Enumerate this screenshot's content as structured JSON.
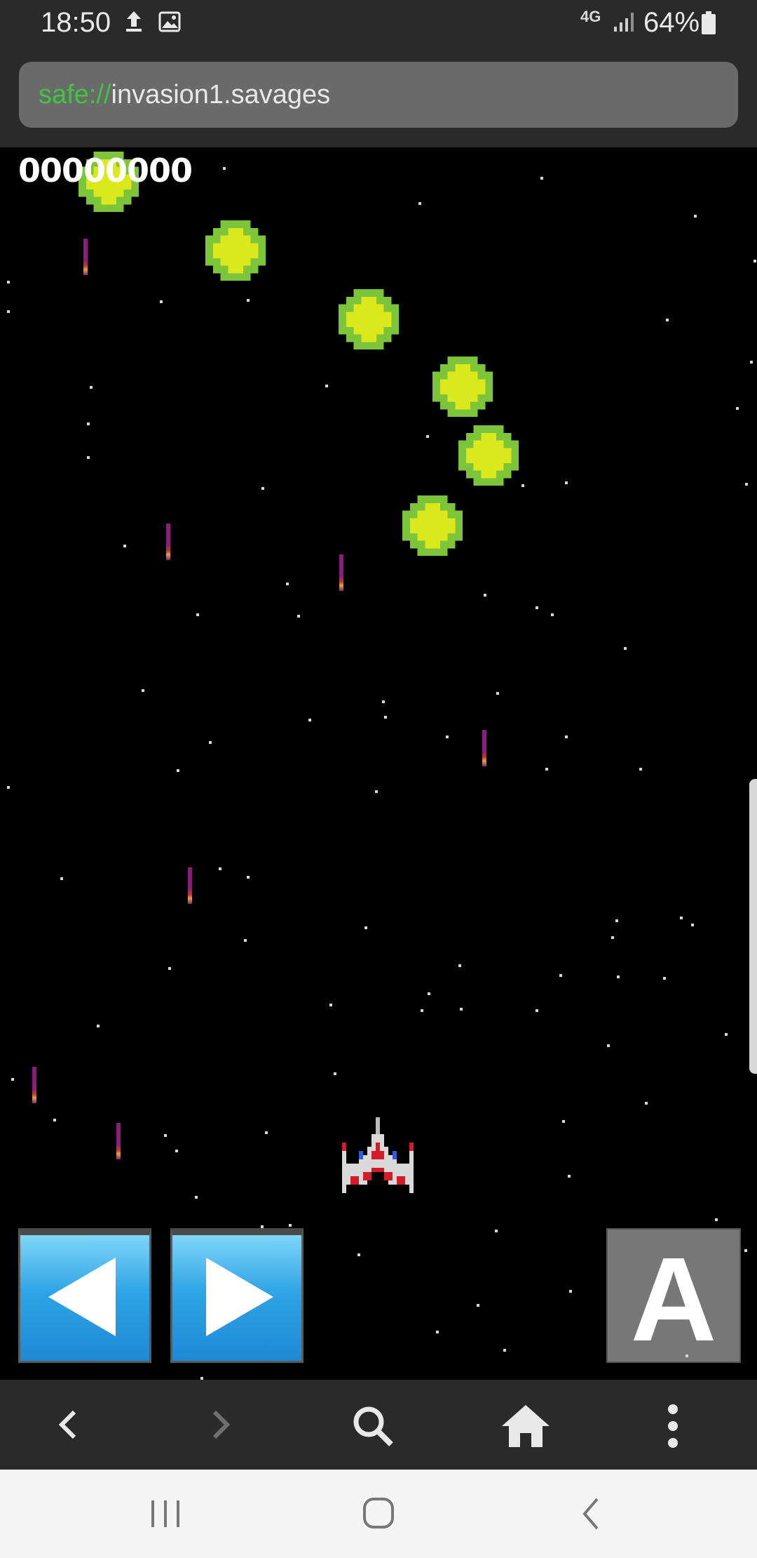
{
  "status_bar": {
    "time": "18:50",
    "network": "4G",
    "battery": "64%",
    "icons": [
      "upload-icon",
      "image-icon",
      "network-4g-icon",
      "signal-icon",
      "battery-icon"
    ]
  },
  "address_bar": {
    "scheme": "safe://",
    "host": "invasion1.savages"
  },
  "game": {
    "score": "00000000",
    "controls": {
      "left_button": "left-arrow-icon",
      "right_button": "right-arrow-icon",
      "a_button_label": "A"
    },
    "colors": {
      "background": "#000000",
      "alien_outer": "#7cc43a",
      "alien_inner": "#dbe81c",
      "bullet": "#8a1f7a",
      "dpad": "#2fa4e6",
      "a_button": "#777777"
    }
  },
  "browser_nav": {
    "icons": [
      "back-icon",
      "forward-icon",
      "search-icon",
      "home-icon",
      "more-icon"
    ]
  },
  "system_nav": {
    "icons": [
      "recent-apps-icon",
      "home-circle-icon",
      "system-back-icon"
    ]
  }
}
